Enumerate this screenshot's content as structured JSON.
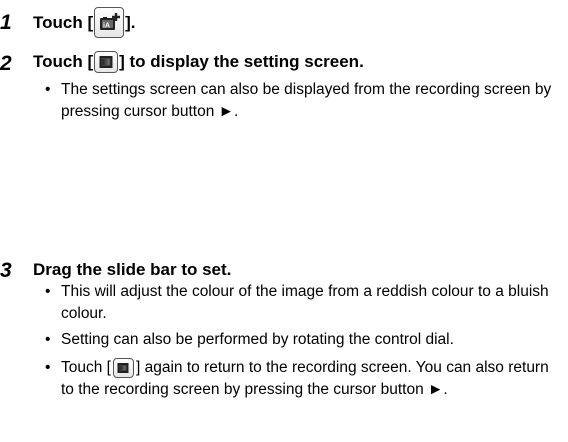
{
  "steps": [
    {
      "number": "1",
      "text_before": "Touch [",
      "icon": "intelligent-auto-icon",
      "text_after": "]."
    },
    {
      "number": "2",
      "text_before": "Touch [",
      "icon": "white-balance-icon",
      "text_after": "] to display the setting screen.",
      "bullets": [
        "The settings screen can also be displayed from the recording screen by pressing cursor button ►."
      ]
    },
    {
      "number": "3",
      "text": "Drag the slide bar to set.",
      "bullets": [
        "This will adjust the colour of the image from a reddish colour to a bluish colour.",
        "Setting can also be performed by rotating the control dial."
      ],
      "bullet_last": {
        "text_before": "Touch [",
        "icon": "white-balance-icon",
        "text_after": "] again to return to the recording screen. You can also return to the recording screen by pressing the cursor button ►."
      }
    }
  ]
}
